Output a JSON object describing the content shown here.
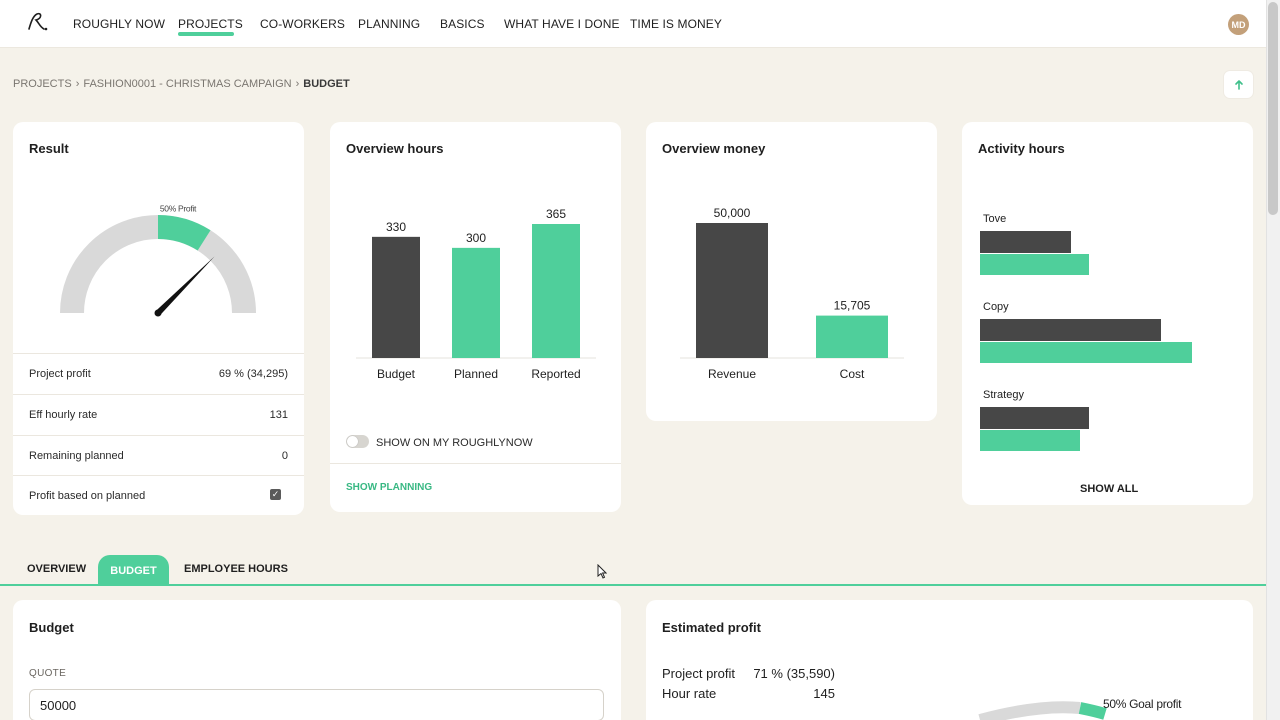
{
  "nav": {
    "logo": "R.",
    "items": [
      "ROUGHLY NOW",
      "PROJECTS",
      "CO-WORKERS",
      "PLANNING",
      "BASICS",
      "WHAT HAVE I DONE",
      "TIME IS MONEY"
    ],
    "active": "PROJECTS",
    "avatar_initials": "MD"
  },
  "breadcrumb": {
    "items": [
      "PROJECTS",
      "FASHION0001 - CHRISTMAS CAMPAIGN",
      "BUDGET"
    ],
    "separator": "›",
    "export_icon": "export-arrow-icon"
  },
  "result": {
    "title": "Result",
    "gauge": {
      "label": "50% Profit",
      "goal_fraction": 0.5,
      "needle_fraction": 0.69
    },
    "rows": [
      {
        "label": "Project profit",
        "value": "69 % (34,295)"
      },
      {
        "label": "Eff hourly rate",
        "value": "131"
      },
      {
        "label": "Remaining planned",
        "value": "0"
      },
      {
        "label": "Profit based on planned",
        "checked": true
      }
    ]
  },
  "overview_hours": {
    "title": "Overview hours",
    "toggle_label": "SHOW ON MY ROUGHLYNOW",
    "toggle_on": false,
    "link": "SHOW PLANNING"
  },
  "overview_money": {
    "title": "Overview money"
  },
  "activity_hours": {
    "title": "Activity hours",
    "show_all": "SHOW ALL"
  },
  "tabs": {
    "items": [
      "OVERVIEW",
      "BUDGET",
      "EMPLOYEE HOURS"
    ],
    "active": "BUDGET"
  },
  "budget": {
    "title": "Budget",
    "quote_label": "QUOTE",
    "quote_value": "50000"
  },
  "estimated_profit": {
    "title": "Estimated profit",
    "rows": [
      {
        "label": "Project profit",
        "value": "71 % (35,590)"
      },
      {
        "label": "Hour rate",
        "value": "145"
      }
    ],
    "goal_label": "50% Goal profit"
  },
  "colors": {
    "accent": "#4fcf9b",
    "dark_bar": "#474747",
    "gauge_bg": "#d9d9d9",
    "page_bg": "#f5f2ea"
  },
  "chart_data": [
    {
      "type": "bar",
      "title": "Overview hours",
      "categories": [
        "Budget",
        "Planned",
        "Reported"
      ],
      "values": [
        330,
        300,
        365
      ],
      "labels": [
        "330",
        "300",
        "365"
      ],
      "colors": [
        "#474747",
        "#4fcf9b",
        "#4fcf9b"
      ],
      "ylim": [
        0,
        365
      ]
    },
    {
      "type": "bar",
      "title": "Overview money",
      "categories": [
        "Revenue",
        "Cost"
      ],
      "values": [
        50000,
        15705
      ],
      "labels": [
        "50,000",
        "15,705"
      ],
      "colors": [
        "#474747",
        "#4fcf9b"
      ],
      "ylim": [
        0,
        50000
      ]
    },
    {
      "type": "bar",
      "title": "Activity hours",
      "orientation": "horizontal",
      "categories": [
        "Tove",
        "Copy",
        "Strategy"
      ],
      "series": [
        {
          "values": [
            91,
            181,
            109
          ],
          "color": "#474747"
        },
        {
          "values": [
            109,
            212,
            100
          ],
          "color": "#4fcf9b"
        }
      ]
    }
  ]
}
